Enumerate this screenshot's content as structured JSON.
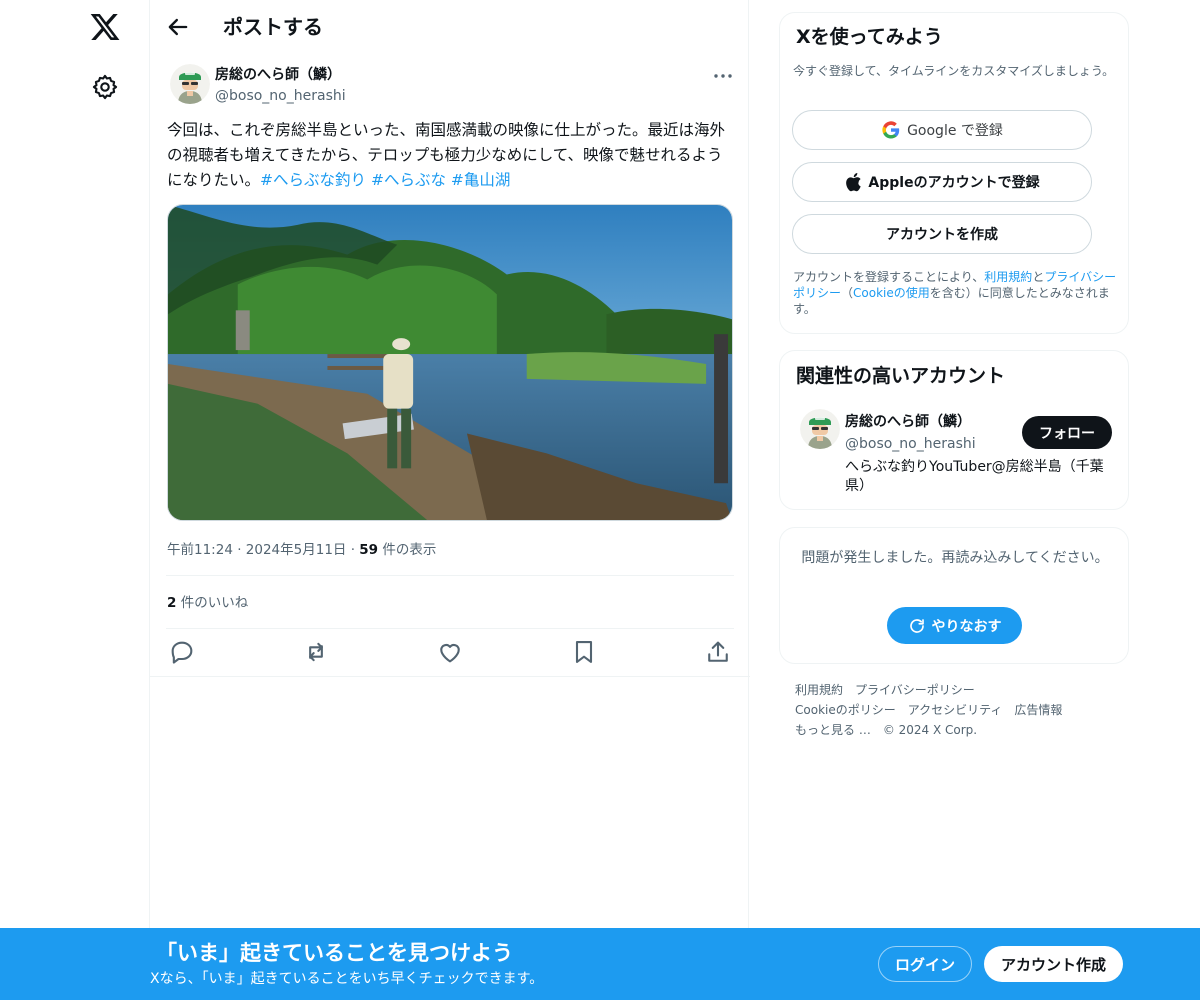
{
  "header": {
    "title": "ポストする"
  },
  "post": {
    "author_name": "房総のへら師（鱗）",
    "author_handle": "@boso_no_herashi",
    "text": "今回は、これぞ房総半島といった、南国感満載の映像に仕上がった。最近は海外の視聴者も増えてきたから、テロップも極力少なめにして、映像で魅せれるようになりたい。",
    "hashtags": [
      "#へらぶな釣り",
      "#へらぶな",
      "#亀山湖"
    ],
    "time": "午前11:24",
    "date": "2024年5月11日",
    "views_count": "59",
    "views_label": "件の表示",
    "likes_count": "2",
    "likes_label": "件のいいね"
  },
  "signup_card": {
    "title": "Xを使ってみよう",
    "subtitle": "今すぐ登録して、タイムラインをカスタマイズしましょう。",
    "google_label": "Google で登録",
    "apple_label": "Appleのアカウントで登録",
    "create_label": "アカウントを作成",
    "legal_prefix": "アカウントを登録することにより、",
    "terms_link": "利用規約",
    "legal_and": "と",
    "privacy_link": "プライバシーポリシー",
    "legal_paren_open": "（",
    "cookie_link": "Cookieの使用",
    "legal_suffix": "を含む）に同意したとみなされます。"
  },
  "related_card": {
    "title": "関連性の高いアカウント",
    "name": "房総のへら師（鱗）",
    "handle": "@boso_no_herashi",
    "bio": "へらぶな釣りYouTuber@房総半島（千葉県）",
    "follow_label": "フォロー"
  },
  "error_card": {
    "message": "問題が発生しました。再読み込みしてください。",
    "retry_label": "やりなおす"
  },
  "footer": {
    "links": [
      "利用規約",
      "プライバシーポリシー",
      "Cookieのポリシー",
      "アクセシビリティ",
      "広告情報",
      "もっと見る …"
    ],
    "copyright": "© 2024 X Corp."
  },
  "bottom_bar": {
    "title": "「いま」起きていることを見つけよう",
    "subtitle": "Xなら、「いま」起きていることをいち早くチェックできます。",
    "login_label": "ログイン",
    "signup_label": "アカウント作成"
  },
  "icons": {
    "logo": "x-logo-icon",
    "settings": "gear-icon",
    "back": "back-arrow-icon",
    "more": "more-dots-icon",
    "reply": "reply-icon",
    "repost": "repost-icon",
    "like": "heart-icon",
    "bookmark": "bookmark-icon",
    "share": "share-icon",
    "retry": "refresh-icon"
  },
  "colors": {
    "accent": "#1d9bf0",
    "text": "#0f1419",
    "secondary": "#536471",
    "border": "#eff3f4"
  }
}
